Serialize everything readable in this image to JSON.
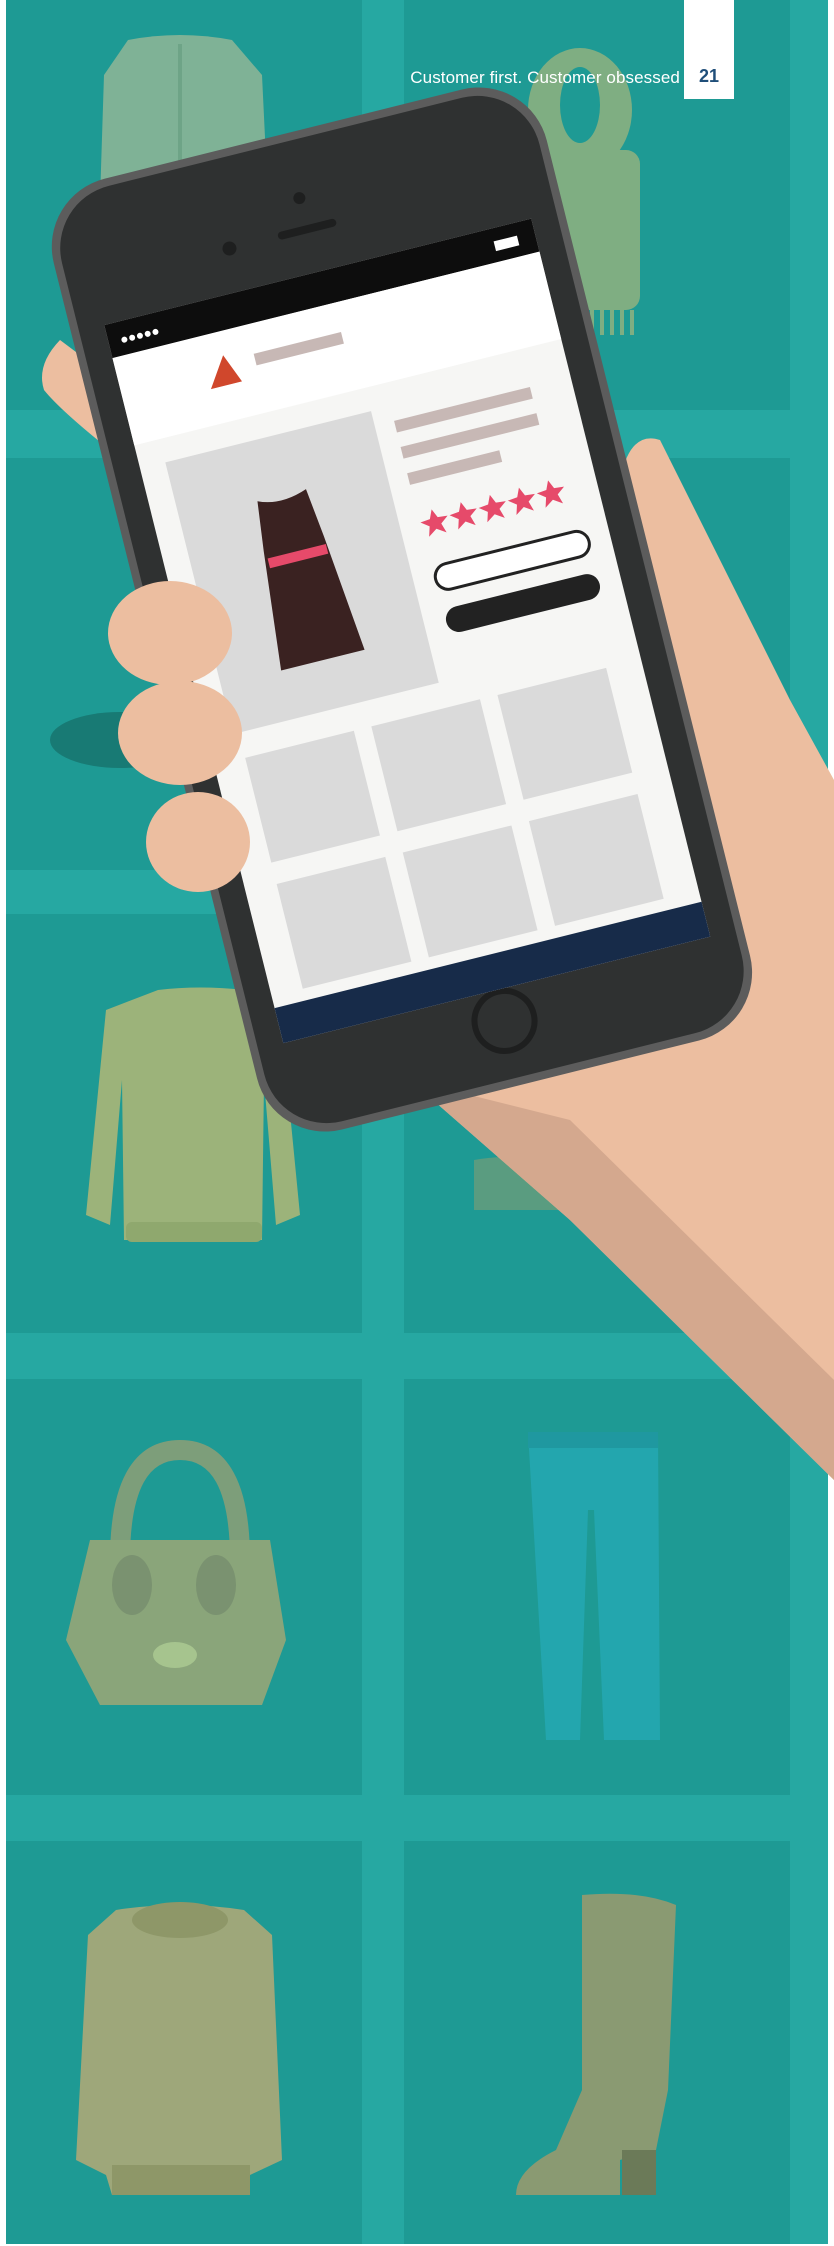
{
  "header": {
    "tagline": "Customer first. Customer obsessed",
    "page_number": "21"
  },
  "colors": {
    "background_teal": "#1E9A94",
    "grid_band": "#26A8A2",
    "skin": "#ECBEA0",
    "phone_body": "#2F3131",
    "accent_red": "#D0472C",
    "star_pink": "#E64A6A",
    "nav_navy": "#172B49",
    "page_number_blue": "#1F4E79"
  },
  "phone": {
    "product_rating_stars": 5,
    "thumbnail_count": 6
  }
}
